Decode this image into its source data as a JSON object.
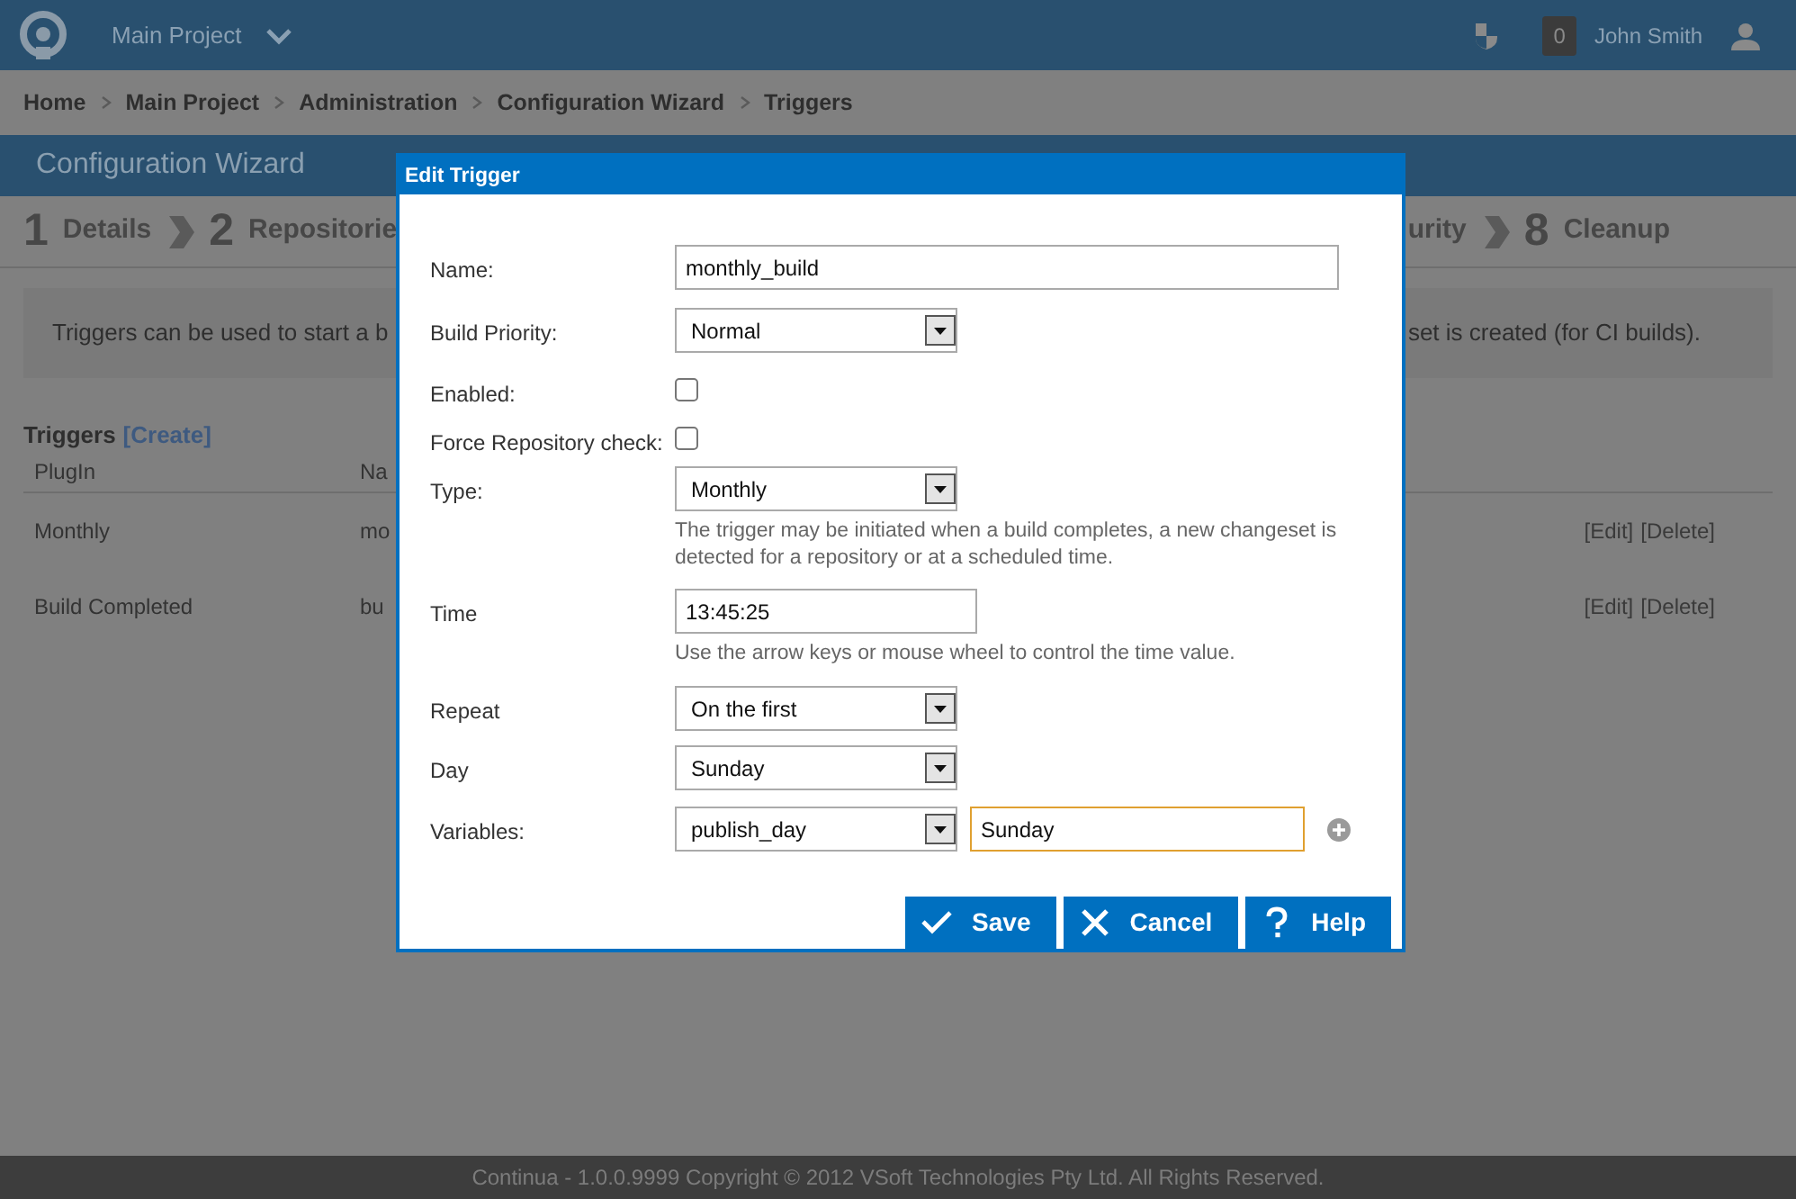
{
  "app": {
    "project": "Main Project",
    "notifications": "0",
    "user": "John Smith"
  },
  "breadcrumb": [
    "Home",
    "Main Project",
    "Administration",
    "Configuration Wizard",
    "Triggers"
  ],
  "wizard": {
    "title": "Configuration Wizard",
    "steps_left": [
      {
        "number": "1",
        "label": "Details"
      },
      {
        "number": "2",
        "label": "Repositorie"
      }
    ],
    "steps_right": [
      {
        "label": "urity"
      },
      {
        "number": "8",
        "label": "Cleanup"
      }
    ]
  },
  "info": {
    "text_left": "Triggers can be used to start a b",
    "text_right": "set is created (for CI builds)."
  },
  "triggers": {
    "title": "Triggers",
    "create": "[Create]",
    "columns": [
      "PlugIn",
      "Na"
    ],
    "rows": [
      {
        "plugin": "Monthly",
        "name": "mo",
        "edit": "[Edit]",
        "delete": "[Delete]"
      },
      {
        "plugin": "Build Completed",
        "name": "bu",
        "edit": "[Edit]",
        "delete": "[Delete]"
      }
    ]
  },
  "dialog": {
    "title": "Edit Trigger",
    "fields": [
      {
        "kind": "text",
        "label": "Name:",
        "value": "monthly_build"
      },
      {
        "kind": "select",
        "label": "Build Priority:",
        "value": "Normal"
      },
      {
        "kind": "checkbox",
        "label": "Enabled:",
        "checked": false
      },
      {
        "kind": "checkbox",
        "label": "Force Repository check:",
        "checked": false
      },
      {
        "kind": "select",
        "label": "Type:",
        "value": "Monthly",
        "help": "The trigger may be initiated when a build completes, a new changeset is detected for a repository or at a scheduled time."
      },
      {
        "kind": "time",
        "label": "Time",
        "value": "13:45:25",
        "help": "Use the arrow keys or mouse wheel to control the time value."
      },
      {
        "kind": "select",
        "label": "Repeat",
        "value": "On the first"
      },
      {
        "kind": "select",
        "label": "Day",
        "value": "Sunday"
      },
      {
        "kind": "variable",
        "label": "Variables:",
        "value": "publish_day",
        "text": "Sunday",
        "focused": true
      }
    ],
    "buttons": [
      {
        "kind": "save",
        "label": "Save"
      },
      {
        "kind": "cancel",
        "label": "Cancel"
      },
      {
        "kind": "help",
        "label": "Help"
      }
    ]
  },
  "footer": "Continua - 1.0.0.9999 Copyright © 2012 VSoft Technologies Pty Ltd. All Rights Reserved."
}
